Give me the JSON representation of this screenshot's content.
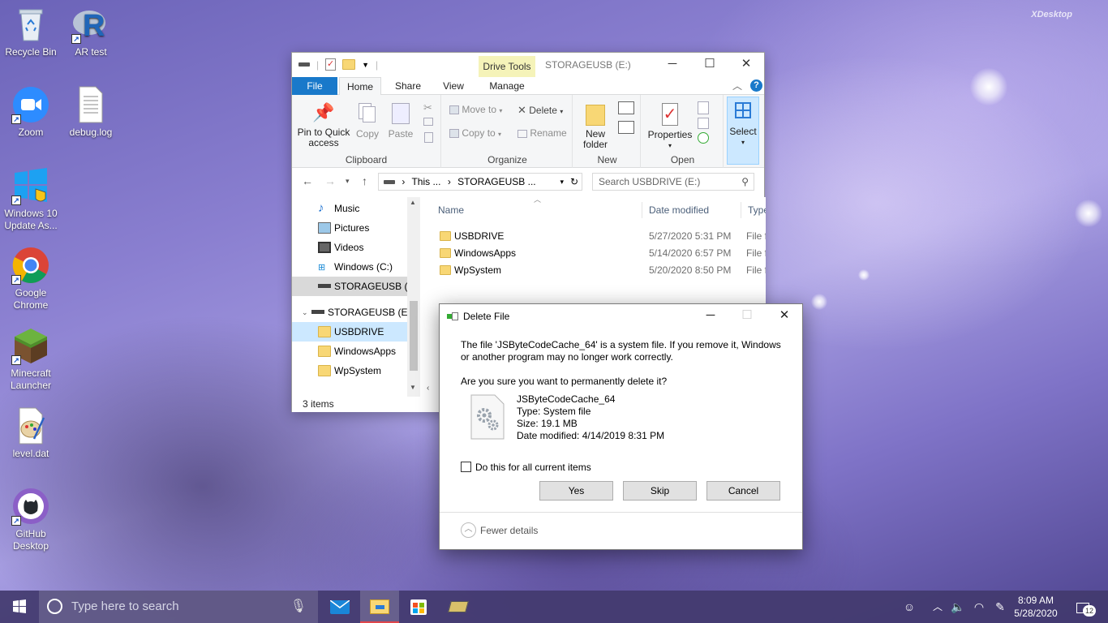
{
  "desktop": {
    "watermark": "XDesktop",
    "icons": [
      {
        "label": "Recycle Bin"
      },
      {
        "label": "AR test"
      },
      {
        "label": "Zoom"
      },
      {
        "label": "debug.log"
      },
      {
        "label": "Windows 10 Update As..."
      },
      {
        "label": "Google Chrome"
      },
      {
        "label": "Minecraft Launcher"
      },
      {
        "label": "level.dat"
      },
      {
        "label": "GitHub Desktop"
      }
    ]
  },
  "explorer": {
    "context_tab": "Drive Tools",
    "title": "STORAGEUSB (E:)",
    "tabs": [
      "File",
      "Home",
      "Share",
      "View",
      "Manage"
    ],
    "ribbon": {
      "clipboard": {
        "label": "Clipboard",
        "pin": "Pin to Quick access",
        "copy": "Copy",
        "paste": "Paste"
      },
      "organize": {
        "label": "Organize",
        "move_to": "Move to",
        "copy_to": "Copy to",
        "delete": "Delete",
        "rename": "Rename"
      },
      "new": {
        "label": "New",
        "new_folder": "New folder"
      },
      "open": {
        "label": "Open",
        "properties": "Properties"
      },
      "select": {
        "label": "Select"
      }
    },
    "address": {
      "seg1": "This ...",
      "seg2": "STORAGEUSB ...",
      "search_placeholder": "Search USBDRIVE (E:)"
    },
    "nav": [
      {
        "label": "Music"
      },
      {
        "label": "Pictures"
      },
      {
        "label": "Videos"
      },
      {
        "label": "Windows (C:)"
      },
      {
        "label": "STORAGEUSB (E:)"
      },
      {
        "label": "STORAGEUSB (E:)"
      },
      {
        "label": "USBDRIVE"
      },
      {
        "label": "WindowsApps"
      },
      {
        "label": "WpSystem"
      }
    ],
    "columns": {
      "name": "Name",
      "date": "Date modified",
      "type": "Type"
    },
    "files": [
      {
        "name": "USBDRIVE",
        "date": "5/27/2020 5:31 PM",
        "type": "File f"
      },
      {
        "name": "WindowsApps",
        "date": "5/14/2020 6:57 PM",
        "type": "File f"
      },
      {
        "name": "WpSystem",
        "date": "5/20/2020 8:50 PM",
        "type": "File f"
      }
    ],
    "status": "3 items"
  },
  "dialog": {
    "title": "Delete File",
    "message": "The file 'JSByteCodeCache_64' is a system file. If you remove it, Windows or another program may no longer work correctly.",
    "question": "Are you sure you want to permanently delete it?",
    "file_name": "JSByteCodeCache_64",
    "file_type": "Type: System file",
    "file_size": "Size: 19.1 MB",
    "file_date": "Date modified: 4/14/2019 8:31 PM",
    "checkbox_label": "Do this for all current items",
    "checkbox_checked": false,
    "yes": "Yes",
    "skip": "Skip",
    "cancel": "Cancel",
    "fewer_details": "Fewer details"
  },
  "taskbar": {
    "search_placeholder": "Type here to search",
    "time": "8:09 AM",
    "date": "5/28/2020",
    "notification_count": "12"
  }
}
